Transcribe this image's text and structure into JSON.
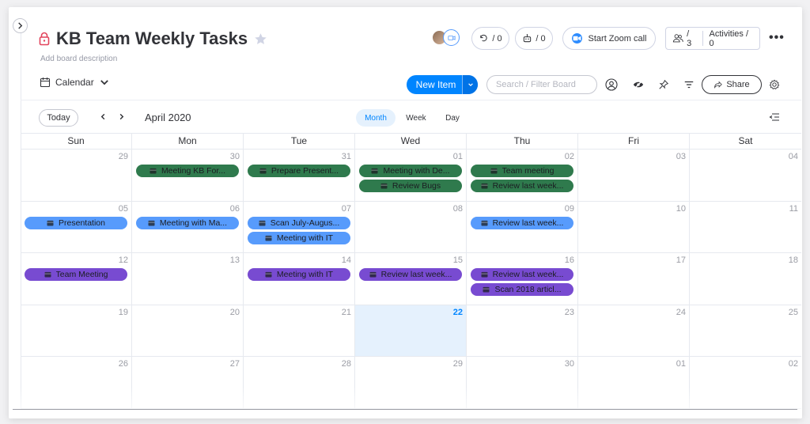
{
  "board": {
    "title": "KB Team Weekly Tasks",
    "description": "Add board description",
    "updates_count": "/ 0",
    "automations_count": "/ 0",
    "zoom_label": "Start Zoom call",
    "members_count": "/ 3",
    "activities_label": "Activities / 0"
  },
  "toolbar": {
    "view_label": "Calendar",
    "new_item_label": "New Item",
    "search_placeholder": "Search / Filter Board",
    "share_label": "Share"
  },
  "calendar_nav": {
    "today_label": "Today",
    "month_label": "April 2020",
    "modes": [
      "Month",
      "Week",
      "Day"
    ],
    "active_mode": "Month"
  },
  "calendar": {
    "weekdays": [
      "Sun",
      "Mon",
      "Tue",
      "Wed",
      "Thu",
      "Fri",
      "Sat"
    ],
    "weeks": [
      [
        {
          "day": "29",
          "events": []
        },
        {
          "day": "30",
          "events": [
            {
              "label": "Meeting KB For...",
              "color": "green"
            }
          ]
        },
        {
          "day": "31",
          "events": [
            {
              "label": "Prepare Present...",
              "color": "green"
            }
          ]
        },
        {
          "day": "01",
          "events": [
            {
              "label": "Meeting with De...",
              "color": "green"
            },
            {
              "label": "Review Bugs",
              "color": "green"
            }
          ]
        },
        {
          "day": "02",
          "events": [
            {
              "label": "Team meeting",
              "color": "green"
            },
            {
              "label": "Review last week...",
              "color": "green"
            }
          ]
        },
        {
          "day": "03",
          "events": []
        },
        {
          "day": "04",
          "events": []
        }
      ],
      [
        {
          "day": "05",
          "events": [
            {
              "label": "Presentation",
              "color": "blue"
            }
          ]
        },
        {
          "day": "06",
          "events": [
            {
              "label": "Meeting with Ma...",
              "color": "blue"
            }
          ]
        },
        {
          "day": "07",
          "events": [
            {
              "label": "Scan July-Augus...",
              "color": "blue"
            },
            {
              "label": "Meeting with IT",
              "color": "blue"
            }
          ]
        },
        {
          "day": "08",
          "events": []
        },
        {
          "day": "09",
          "events": [
            {
              "label": "Review last week...",
              "color": "blue"
            }
          ]
        },
        {
          "day": "10",
          "events": []
        },
        {
          "day": "11",
          "events": []
        }
      ],
      [
        {
          "day": "12",
          "events": [
            {
              "label": "Team Meeting",
              "color": "purple"
            }
          ]
        },
        {
          "day": "13",
          "events": []
        },
        {
          "day": "14",
          "events": [
            {
              "label": "Meeting with IT",
              "color": "purple"
            }
          ]
        },
        {
          "day": "15",
          "events": [
            {
              "label": "Review last week...",
              "color": "purple"
            }
          ]
        },
        {
          "day": "16",
          "events": [
            {
              "label": "Review last week...",
              "color": "purple"
            },
            {
              "label": "Scan 2018 articl...",
              "color": "purple"
            }
          ]
        },
        {
          "day": "17",
          "events": []
        },
        {
          "day": "18",
          "events": []
        }
      ],
      [
        {
          "day": "19",
          "events": []
        },
        {
          "day": "20",
          "events": []
        },
        {
          "day": "21",
          "events": []
        },
        {
          "day": "22",
          "events": [],
          "today": true
        },
        {
          "day": "23",
          "events": []
        },
        {
          "day": "24",
          "events": []
        },
        {
          "day": "25",
          "events": []
        }
      ],
      [
        {
          "day": "26",
          "events": []
        },
        {
          "day": "27",
          "events": []
        },
        {
          "day": "28",
          "events": []
        },
        {
          "day": "29",
          "events": []
        },
        {
          "day": "30",
          "events": []
        },
        {
          "day": "01",
          "events": []
        },
        {
          "day": "02",
          "events": []
        }
      ]
    ]
  },
  "colors": {
    "accent": "#0085ff",
    "green": "#2f7a4d",
    "blue": "#579bfc",
    "purple": "#784bd1",
    "lock": "#e2445c"
  }
}
